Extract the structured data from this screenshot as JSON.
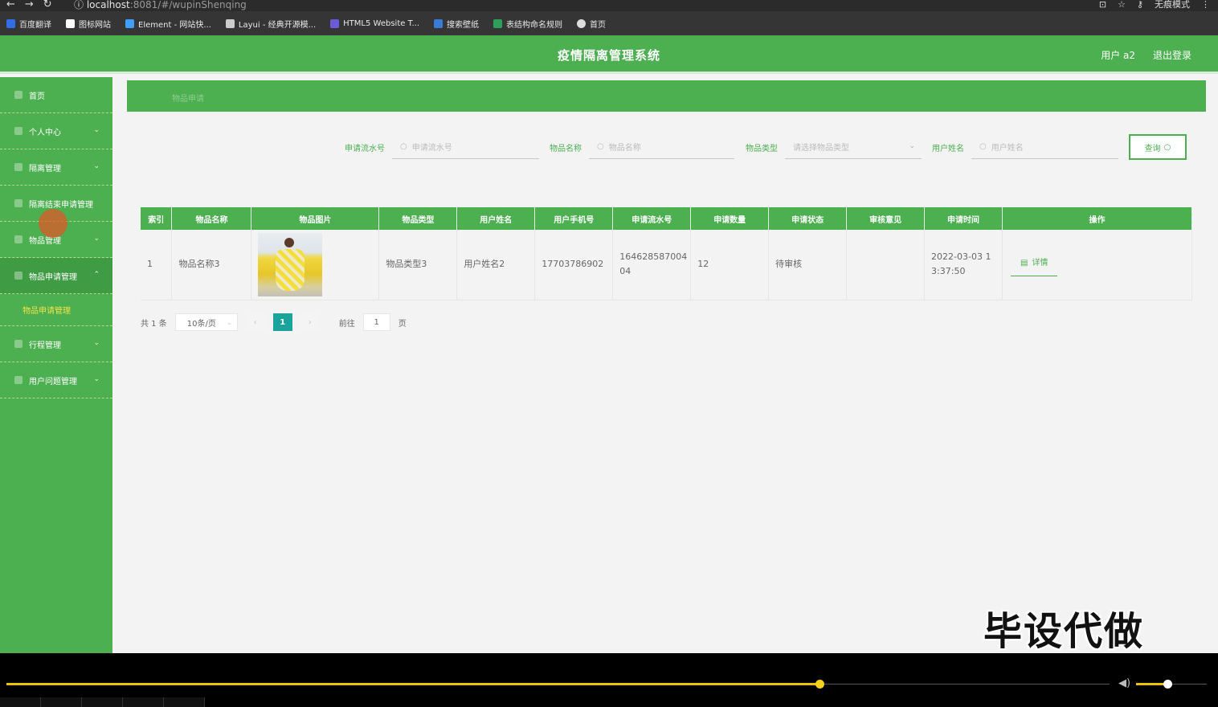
{
  "browser": {
    "url_host": "localhost",
    "url_rest": ":8081/#/wupinShenqing",
    "incognito_label": "无痕模式",
    "bookmarks": [
      {
        "label": "百度翻译",
        "color": "#2f6ee6"
      },
      {
        "label": "图标网站",
        "color": "#ffffff"
      },
      {
        "label": "Element - 网站快...",
        "color": "#409eff"
      },
      {
        "label": "Layui - 经典开源模...",
        "color": "#cccccc"
      },
      {
        "label": "HTML5 Website T...",
        "color": "#6b5bd6"
      },
      {
        "label": "搜索壁纸",
        "color": "#3a7bd5"
      },
      {
        "label": "表结构命名规则",
        "color": "#2e9e5b"
      },
      {
        "label": "首页",
        "color": "#dddddd"
      }
    ]
  },
  "header": {
    "title": "疫情隔离管理系统",
    "user": "用户 a2",
    "logout": "退出登录"
  },
  "sidebar": {
    "items": [
      {
        "label": "首页",
        "arrow": ""
      },
      {
        "label": "个人中心",
        "arrow": "⌄"
      },
      {
        "label": "隔离管理",
        "arrow": "⌄"
      },
      {
        "label": "隔离结束申请管理",
        "arrow": ""
      },
      {
        "label": "物品管理",
        "arrow": "⌄"
      },
      {
        "label": "物品申请管理",
        "arrow": "⌃"
      }
    ],
    "submenu": "物品申请管理",
    "items_after": [
      {
        "label": "行程管理",
        "arrow": "⌄"
      },
      {
        "label": "用户问题管理",
        "arrow": "⌄"
      }
    ]
  },
  "breadcrumb": "物品申请",
  "search": {
    "f1_label": "申请流水号",
    "f1_placeholder": "申请流水号",
    "f2_label": "物品名称",
    "f2_placeholder": "物品名称",
    "f3_label": "物品类型",
    "f3_placeholder": "请选择物品类型",
    "f4_label": "用户姓名",
    "f4_placeholder": "用户姓名",
    "button": "查询"
  },
  "table": {
    "headers": [
      "索引",
      "物品名称",
      "物品图片",
      "物品类型",
      "用户姓名",
      "用户手机号",
      "申请流水号",
      "申请数量",
      "申请状态",
      "审核意见",
      "申请时间",
      "操作"
    ],
    "rows": [
      {
        "index": "1",
        "name": "物品名称3",
        "type": "物品类型3",
        "user": "用户姓名2",
        "phone": "17703786902",
        "serial": "164628587004 04",
        "qty": "12",
        "status": "待审核",
        "opinion": "",
        "time": "2022-03-03 1 3:37:50",
        "action": "详情"
      }
    ]
  },
  "pager": {
    "total": "共 1 条",
    "size": "10条/页",
    "current": "1",
    "goto_label": "前往",
    "goto_value": "1",
    "page_suffix": "页"
  },
  "watermark": "毕设代做",
  "player": {
    "progress": 0.67,
    "volume": 0.45
  }
}
